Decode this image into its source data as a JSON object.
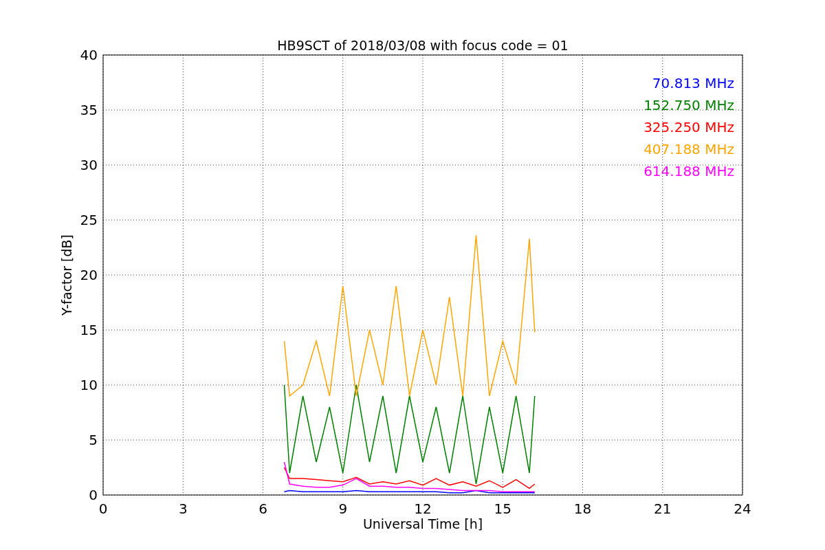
{
  "figure": {
    "chart_data": {
      "type": "line",
      "title": "HB9SCT of 2018/03/08 with focus code = 01",
      "xlabel": "Universal Time [h]",
      "ylabel": "Y-factor [dB]",
      "x": [
        6.8,
        7,
        7.5,
        8,
        8.5,
        9,
        9.5,
        10,
        10.5,
        11,
        11.5,
        12,
        12.5,
        13,
        13.5,
        14,
        14.5,
        15,
        15.5,
        16,
        16.2
      ],
      "series": [
        {
          "name": "70.813 MHz",
          "color": "#0000ff",
          "values": [
            0.3,
            0.4,
            0.3,
            0.3,
            0.3,
            0.3,
            0.4,
            0.3,
            0.3,
            0.3,
            0.3,
            0.3,
            0.3,
            0.2,
            0.2,
            0.4,
            0.2,
            0.2,
            0.2,
            0.2,
            0.2
          ]
        },
        {
          "name": "152.750 MHz",
          "color": "#008000",
          "values": [
            10,
            2,
            9,
            3,
            8,
            2,
            10,
            3,
            9,
            2,
            9,
            3,
            8,
            2,
            9,
            1,
            8,
            2,
            9,
            2,
            9
          ]
        },
        {
          "name": "325.250 MHz",
          "color": "#ff0000",
          "values": [
            2.5,
            1.5,
            1.5,
            1.4,
            1.3,
            1.2,
            1.6,
            1.0,
            1.2,
            1.0,
            1.3,
            0.9,
            1.5,
            0.9,
            1.2,
            0.8,
            1.3,
            0.7,
            1.4,
            0.6,
            1.0
          ]
        },
        {
          "name": "407.188 MHz",
          "color": "#ffa500",
          "values": [
            14,
            9,
            10,
            14,
            9,
            19,
            9,
            15,
            10,
            19,
            9,
            15,
            10,
            18,
            9,
            23.6,
            9,
            14,
            10,
            23.3,
            14.8
          ]
        },
        {
          "name": "614.188 MHz",
          "color": "#ff00ff",
          "values": [
            3,
            1,
            0.8,
            0.7,
            0.7,
            0.9,
            1.5,
            0.8,
            0.8,
            0.7,
            0.7,
            0.6,
            0.6,
            0.5,
            0.4,
            0.4,
            0.4,
            0.3,
            0.3,
            0.3,
            0.3
          ]
        }
      ],
      "xlim": [
        0,
        24
      ],
      "ylim": [
        0,
        40
      ],
      "xticks": [
        0,
        3,
        6,
        9,
        12,
        15,
        18,
        21,
        24
      ],
      "yticks": [
        0,
        5,
        10,
        15,
        20,
        25,
        30,
        35,
        40
      ],
      "grid": true
    }
  }
}
